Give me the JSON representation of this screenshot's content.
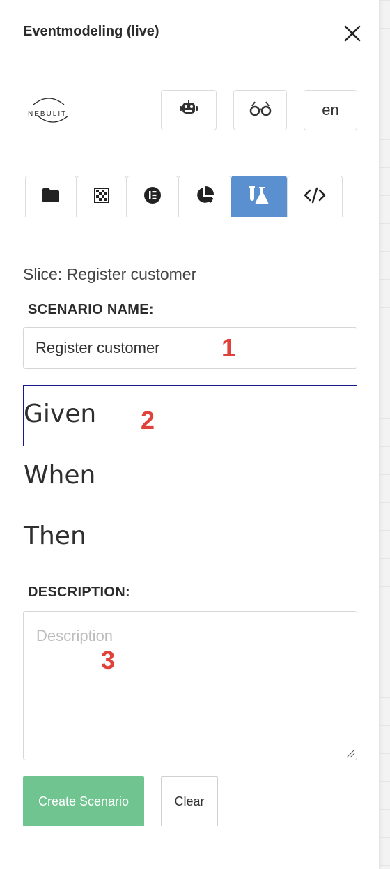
{
  "header": {
    "title": "Eventmodeling (live)"
  },
  "logo": {
    "text": "NEBULIT"
  },
  "toolbar": {
    "icons": [
      "robot-icon",
      "glasses-icon"
    ],
    "language": "en"
  },
  "tabs": [
    {
      "icon": "folder-icon"
    },
    {
      "icon": "checkerboard-icon"
    },
    {
      "icon": "elementor-icon"
    },
    {
      "icon": "pie-chart-icon"
    },
    {
      "icon": "flask-icon",
      "active": true
    },
    {
      "icon": "code-icon"
    }
  ],
  "slice": {
    "text": "Slice: Register customer"
  },
  "scenario": {
    "name_label": "SCENARIO NAME:",
    "name_value": "Register customer",
    "given": "Given",
    "when": "When",
    "then": "Then"
  },
  "description": {
    "label": "DESCRIPTION:",
    "placeholder": "Description"
  },
  "buttons": {
    "create": "Create Scenario",
    "clear": "Clear"
  },
  "markers": [
    "1",
    "2",
    "3"
  ],
  "colors": {
    "active_tab": "#5a8fd0",
    "create_button": "#6fc490",
    "given_border": "#1a1a8c",
    "marker": "#e0413a"
  }
}
